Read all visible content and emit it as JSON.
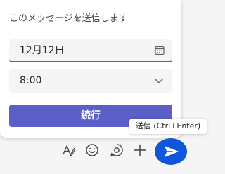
{
  "schedule_popup": {
    "title": "このメッセージを送信します",
    "date_value": "12月12日",
    "time_value": "8:00",
    "continue_label": "続行"
  },
  "tooltip": {
    "text": "送信 (Ctrl+Enter)"
  },
  "toolbar": {
    "icons": [
      "format-icon",
      "emoji-icon",
      "loop-icon",
      "add-icon",
      "send-icon"
    ]
  },
  "colors": {
    "accent": "#5b5fc7",
    "send_highlight": "#0f56d9",
    "background": "#f5f5f5"
  }
}
